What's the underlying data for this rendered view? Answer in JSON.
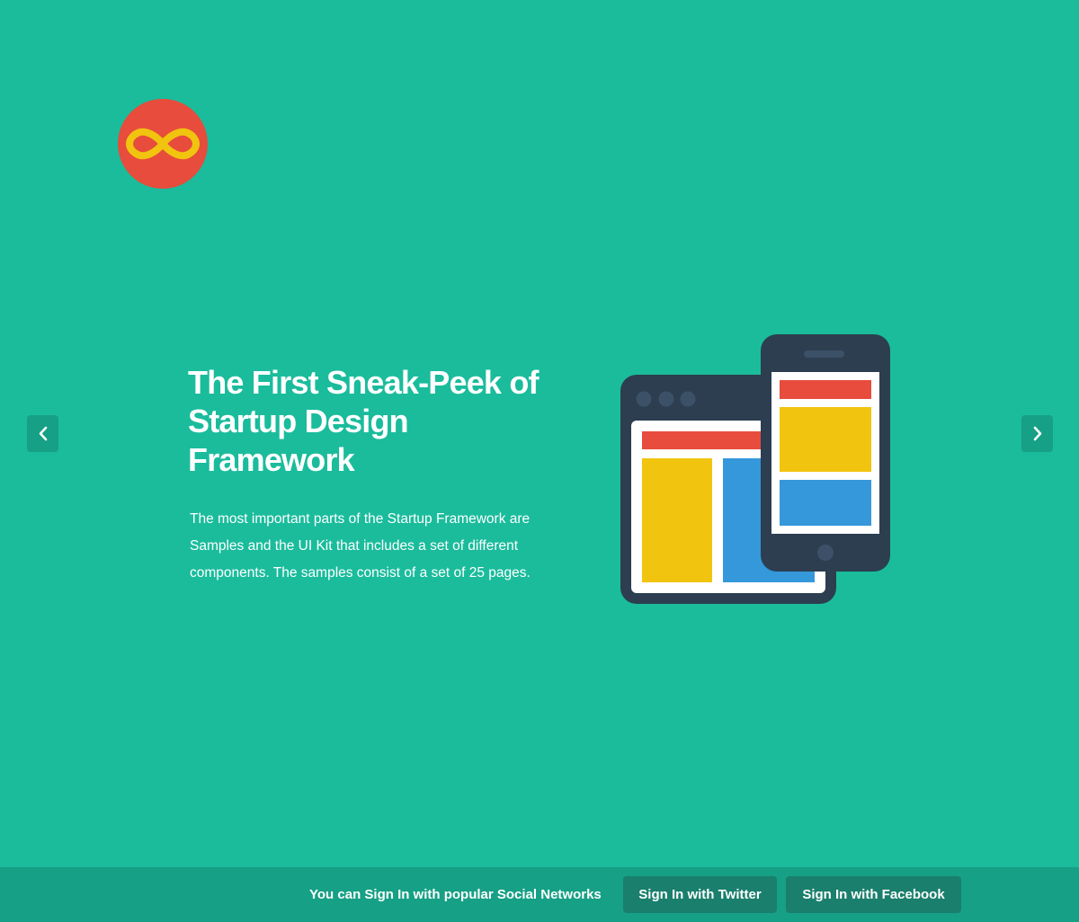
{
  "brand": {
    "logo_icon": "infinity-logo-icon",
    "colors": {
      "background": "#1abc9c",
      "dark_accent": "#16a085",
      "logo_circle": "#e74c3c",
      "logo_symbol": "#f1c40f"
    }
  },
  "carousel": {
    "prev_icon": "chevron-left-icon",
    "next_icon": "chevron-right-icon"
  },
  "hero": {
    "title": "The First Sneak-Peek of Startup Design Framework",
    "text": "The most important parts of the Startup Framework are Samples and the UI Kit that includes a set of different components. The samples consist of a set of 25 pages.",
    "illustration": "devices-illustration",
    "illustration_colors": {
      "device_frame": "#2c3e50",
      "red": "#e74c3c",
      "yellow": "#f1c40f",
      "blue": "#3498db",
      "screen": "#ffffff"
    }
  },
  "footer": {
    "text": "You can Sign In with popular Social Networks",
    "twitter_label": "Sign In with Twitter",
    "facebook_label": "Sign In with Facebook"
  }
}
